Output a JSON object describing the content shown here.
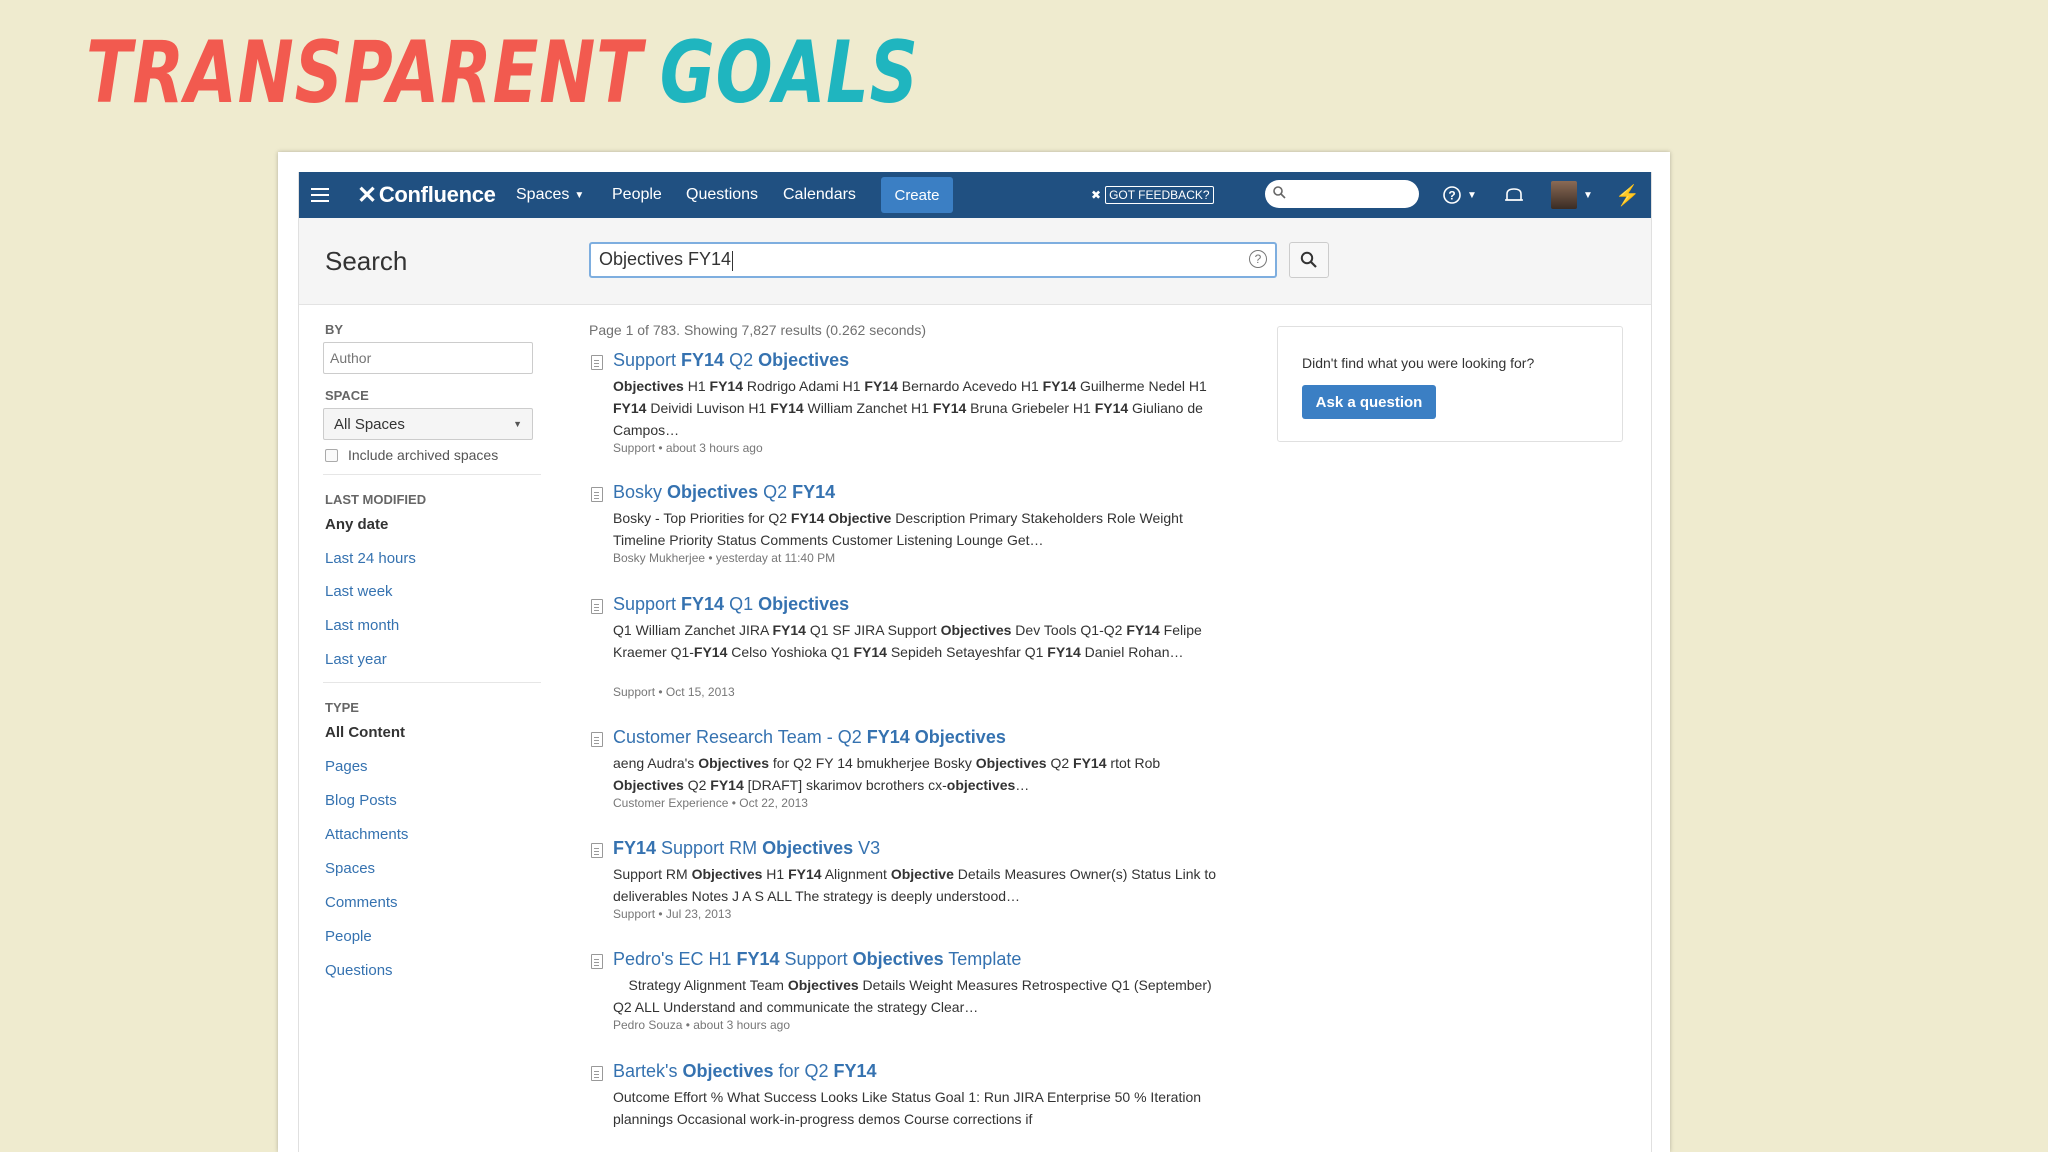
{
  "slide": {
    "title_word1": "TRANSPARENT",
    "title_word2": "GOALS"
  },
  "colors": {
    "header_bg": "#205081",
    "link": "#3572b0",
    "accent_button": "#3b7fc4",
    "title_red": "#f25a4f",
    "title_teal": "#1fb5bf"
  },
  "header": {
    "logo": "Confluence",
    "nav": {
      "spaces": "Spaces",
      "people": "People",
      "questions": "Questions",
      "calendars": "Calendars"
    },
    "create": "Create",
    "feedback": "GOT FEEDBACK?",
    "icons": [
      "menu-icon",
      "search-icon",
      "help-icon",
      "notifications-icon",
      "avatar",
      "bolt-icon"
    ]
  },
  "search": {
    "title": "Search",
    "query": "Objectives FY14"
  },
  "sidebar": {
    "by_label": "BY",
    "author_placeholder": "Author",
    "space_label": "SPACE",
    "space_selected": "All Spaces",
    "include_archived": "Include archived spaces",
    "last_modified_label": "LAST MODIFIED",
    "modified_options": [
      "Any date",
      "Last 24 hours",
      "Last week",
      "Last month",
      "Last year"
    ],
    "type_label": "TYPE",
    "type_options": [
      "All Content",
      "Pages",
      "Blog Posts",
      "Attachments",
      "Spaces",
      "Comments",
      "People",
      "Questions"
    ]
  },
  "results": {
    "summary": "Page 1 of 783. Showing 7,827 results (0.262 seconds)",
    "items": [
      {
        "title": "Support <b>FY14</b> Q2 <b>Objectives</b>",
        "body": "<b>Objectives</b> H1 <b>FY14</b> Rodrigo Adami H1 <b>FY14</b> Bernardo Acevedo H1 <b>FY14</b> Guilherme Nedel H1 <b>FY14</b> Deividi Luvison H1 <b>FY14</b> William Zanchet H1 <b>FY14</b> Bruna Griebeler H1 <b>FY14</b> Giuliano de Campos…",
        "footer": "Support • about 3 hours ago"
      },
      {
        "title": "Bosky <b>Objectives</b> Q2 <b>FY14</b>",
        "body": "Bosky - Top Priorities for Q2 <b>FY14 Objective</b> Description Primary Stakeholders Role Weight Timeline Priority Status Comments Customer Listening Lounge Get…",
        "footer": "Bosky Mukherjee • yesterday at 11:40 PM"
      },
      {
        "title": "Support <b>FY14</b> Q1 <b>Objectives</b>",
        "body": "Q1 William Zanchet JIRA <b>FY14</b> Q1 SF JIRA Support <b>Objectives</b> Dev Tools Q1-Q2 <b>FY14</b> Felipe Kraemer Q1-<b>FY14</b> Celso Yoshioka Q1 <b>FY14</b> Sepideh Setayeshfar Q1 <b>FY14</b> Daniel Rohan…",
        "footer": "Support • Oct 15, 2013"
      },
      {
        "title": "Customer Research Team - Q2 <b>FY14 Objectives</b>",
        "body": "aeng Audra's <b>Objectives</b> for Q2 FY 14  bmukherjee Bosky <b>Objectives</b> Q2 <b>FY14</b> rtot Rob <b>Objectives</b> Q2 <b>FY14</b> [DRAFT] skarimov   bcrothers   cx-<b>objectives</b>…",
        "footer": "Customer Experience • Oct 22, 2013"
      },
      {
        "title": "<b>FY14</b> Support RM <b>Objectives</b> V3",
        "body": "Support RM <b>Objectives</b> H1 <b>FY14</b> Alignment <b>Objective</b> Details Measures Owner(s) Status Link to deliverables Notes J A S ALL The strategy is deeply understood…",
        "footer": "Support • Jul 23, 2013"
      },
      {
        "title": "Pedro's EC H1 <b>FY14</b> Support <b>Objectives</b> Template",
        "body": "&nbsp;&nbsp;&nbsp;&nbsp;Strategy Alignment Team <b>Objectives</b> Details Weight Measures Retrospective   Q1 (September) Q2 ALL Understand and communicate the strategy Clear…",
        "footer": "Pedro Souza • about 3 hours ago"
      },
      {
        "title": "Bartek's <b>Objectives</b> for Q2 <b>FY14</b>",
        "body": "Outcome Effort % What Success Looks Like Status Goal 1: Run JIRA Enterprise 50 % Iteration plannings Occasional work-in-progress demos Course corrections if",
        "footer": ""
      }
    ]
  },
  "help_panel": {
    "text": "Didn't find what you were looking for?",
    "button": "Ask a question"
  }
}
